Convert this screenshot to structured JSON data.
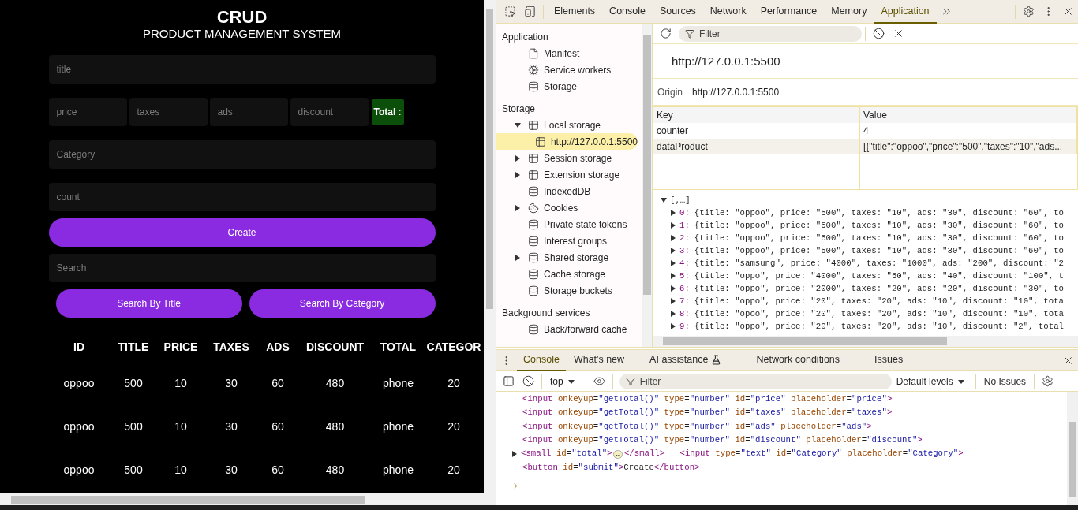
{
  "page": {
    "title": "CRUD",
    "subtitle": "PRODUCT MANAGEMENT SYSTEM",
    "title_field": {
      "placeholder": "title"
    },
    "price_fields": [
      {
        "placeholder": "price"
      },
      {
        "placeholder": "taxes"
      },
      {
        "placeholder": "ads"
      },
      {
        "placeholder": "discount"
      }
    ],
    "total": "Total :",
    "category_field": {
      "placeholder": "Category"
    },
    "count_field": {
      "placeholder": "count"
    },
    "create_button": "Create",
    "search_field": {
      "placeholder": "Search"
    },
    "search_buttons": [
      "Search By Title",
      "Search By Category"
    ],
    "table": {
      "columns": [
        "ID",
        "TITLE",
        "PRICE",
        "TAXES",
        "ADS",
        "DISCOUNT",
        "TOTAL",
        "CATEGOR"
      ],
      "rows": [
        [
          "oppoo",
          "500",
          "10",
          "30",
          "60",
          "480",
          "phone",
          "20"
        ],
        [
          "oppoo",
          "500",
          "10",
          "30",
          "60",
          "480",
          "phone",
          "20"
        ],
        [
          "oppoo",
          "500",
          "10",
          "30",
          "60",
          "480",
          "phone",
          "20"
        ]
      ]
    }
  },
  "devtools": {
    "tabs": [
      {
        "label": "Elements",
        "selected": false
      },
      {
        "label": "Console",
        "selected": false
      },
      {
        "label": "Sources",
        "selected": false
      },
      {
        "label": "Network",
        "selected": false
      },
      {
        "label": "Performance",
        "selected": false
      },
      {
        "label": "Memory",
        "selected": false
      },
      {
        "label": "Application",
        "selected": true
      }
    ],
    "sidebar": [
      {
        "title": "Application",
        "items": [
          {
            "label": "Manifest",
            "kind": "file",
            "expandable": false
          },
          {
            "label": "Service workers",
            "kind": "gears",
            "expandable": false
          },
          {
            "label": "Storage",
            "kind": "database",
            "expandable": false
          }
        ]
      },
      {
        "title": "Storage",
        "items": [
          {
            "label": "Local storage",
            "kind": "table",
            "expandable": true,
            "expanded": true,
            "children": [
              {
                "label": "http://127.0.0.1:5500",
                "kind": "table",
                "expandable": false,
                "selected": true
              }
            ]
          },
          {
            "label": "Session storage",
            "kind": "table",
            "expandable": true,
            "expanded": false
          },
          {
            "label": "Extension storage",
            "kind": "table",
            "expandable": true,
            "expanded": false
          },
          {
            "label": "IndexedDB",
            "kind": "database",
            "expandable": false
          },
          {
            "label": "Cookies",
            "kind": "cookie",
            "expandable": true,
            "expanded": false
          },
          {
            "label": "Private state tokens",
            "kind": "database",
            "expandable": false
          },
          {
            "label": "Interest groups",
            "kind": "database",
            "expandable": false
          },
          {
            "label": "Shared storage",
            "kind": "database",
            "expandable": true,
            "expanded": false
          },
          {
            "label": "Cache storage",
            "kind": "database",
            "expandable": false
          },
          {
            "label": "Storage buckets",
            "kind": "database",
            "expandable": false
          }
        ]
      },
      {
        "title": "Background services",
        "items": [
          {
            "label": "Back/forward cache",
            "kind": "database",
            "expandable": false
          }
        ]
      }
    ],
    "storage": {
      "filter_placeholder": "Filter",
      "origin_heading": "http://127.0.0.1:5500",
      "origin_label": "Origin",
      "origin_value": "http://127.0.0.1:5500",
      "columns": [
        "Key",
        "Value"
      ],
      "rows": [
        {
          "key": "counter",
          "value": "4",
          "selected": false
        },
        {
          "key": "dataProduct",
          "value": "[{\"title\":\"oppoo\",\"price\":\"500\",\"taxes\":\"10\",\"ads...",
          "selected": true
        }
      ],
      "preview": {
        "summary": "[,…]",
        "items": [
          {
            "index": "0:",
            "text": "{title: \"oppoo\", price: \"500\", taxes: \"10\", ads: \"30\", discount: \"60\", to"
          },
          {
            "index": "1:",
            "text": "{title: \"oppoo\", price: \"500\", taxes: \"10\", ads: \"30\", discount: \"60\", to"
          },
          {
            "index": "2:",
            "text": "{title: \"oppoo\", price: \"500\", taxes: \"10\", ads: \"30\", discount: \"60\", to"
          },
          {
            "index": "3:",
            "text": "{title: \"oppoo\", price: \"500\", taxes: \"10\", ads: \"30\", discount: \"60\", to"
          },
          {
            "index": "4:",
            "text": "{title: \"samsung\", price: \"4000\", taxes: \"1000\", ads: \"200\", discount: \"2"
          },
          {
            "index": "5:",
            "text": "{title: \"oppo\", price: \"4000\", taxes: \"50\", ads: \"40\", discount: \"100\", t"
          },
          {
            "index": "6:",
            "text": "{title: \"oppo\", price: \"2000\", taxes: \"20\", ads: \"20\", discount: \"30\", to"
          },
          {
            "index": "7:",
            "text": "{title: \"oppo\", price: \"20\", taxes: \"20\", ads: \"10\", discount: \"10\", tota"
          },
          {
            "index": "8:",
            "text": "{title: \"opoo\", price: \"20\", taxes: \"20\", ads: \"10\", discount: \"10\", tota"
          },
          {
            "index": "9:",
            "text": "{title: \"oppo\", price: \"20\", taxes: \"20\", ads: \"10\", discount: \"2\", total"
          }
        ]
      }
    },
    "drawer": {
      "tabs": [
        {
          "label": "Console",
          "selected": true
        },
        {
          "label": "What's new",
          "selected": false
        },
        {
          "label": "AI assistance",
          "selected": false,
          "beta": true
        },
        {
          "label": "Network conditions",
          "selected": false
        },
        {
          "label": "Issues",
          "selected": false
        }
      ],
      "context": "top",
      "filter_placeholder": "Filter",
      "levels": "Default levels",
      "issues": "No Issues",
      "lines": [
        {
          "text": "<input onkeyup=\"getTotal()\" type=\"number\" id=\"price\" placeholder=\"price\">",
          "expandable": false
        },
        {
          "text": "<input onkeyup=\"getTotal()\" type=\"number\" id=\"taxes\" placeholder=\"taxes\">",
          "expandable": false
        },
        {
          "text": "<input onkeyup=\"getTotal()\" type=\"number\" id=\"ads\" placeholder=\"ads\">",
          "expandable": false
        },
        {
          "text": "<input onkeyup=\"getTotal()\" type=\"number\" id=\"discount\" placeholder=\"discount\">",
          "expandable": false
        },
        {
          "text": "<small id=\"total\">",
          "badge": "…",
          "rest": "</small>   <input type=\"text\" id=\"Category\" placeholder=\"Category\">",
          "expandable": true
        },
        {
          "text": "<button id=\"submit\">Create</button>",
          "expandable": false
        }
      ]
    }
  }
}
